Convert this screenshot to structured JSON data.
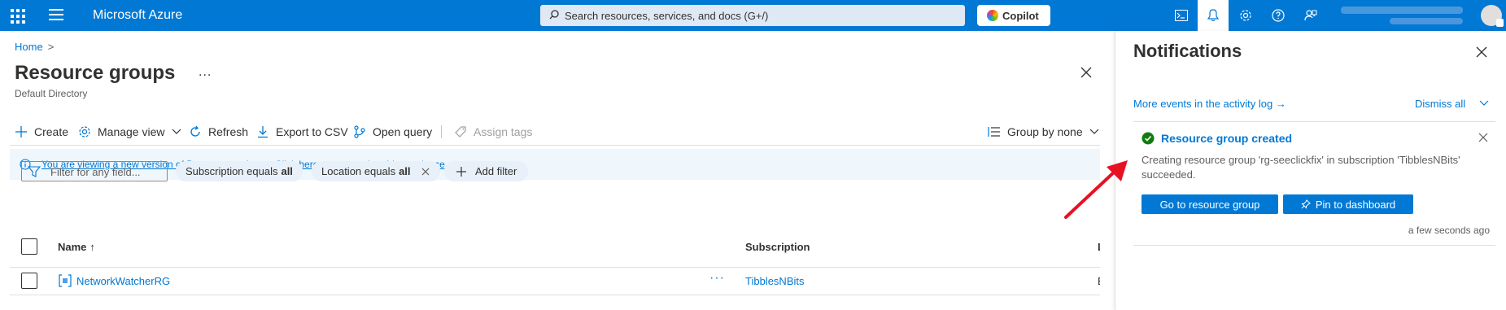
{
  "header": {
    "brand": "Microsoft Azure",
    "search_placeholder": "Search resources, services, and docs (G+/)",
    "copilot_label": "Copilot",
    "icons": [
      "waffle-icon",
      "hamburger-icon",
      "cloud-shell-icon",
      "bell-icon",
      "gear-icon",
      "help-icon",
      "feedback-icon"
    ]
  },
  "breadcrumb": {
    "home": "Home",
    "sep": ">"
  },
  "page": {
    "title": "Resource groups",
    "more": "...",
    "subtitle": "Default Directory"
  },
  "toolbar": {
    "create": "Create",
    "manage_view": "Manage view",
    "refresh": "Refresh",
    "export": "Export to CSV",
    "open_query": "Open query",
    "assign_tags": "Assign tags",
    "group_by": "Group by none"
  },
  "info_banner": "You are viewing a new version of Browse experience. Click here to access the old experience.",
  "filters": {
    "search_placeholder": "Filter for any field...",
    "subscription_label": "Subscription equals",
    "subscription_value": "all",
    "location_label": "Location equals",
    "location_value": "all",
    "add_filter": "Add filter"
  },
  "grid": {
    "columns": {
      "name": "Name",
      "sort_arrow": "↑",
      "subscription": "Subscription",
      "location": "L"
    },
    "rows": [
      {
        "name": "NetworkWatcherRG",
        "subscription": "TibblesNBits",
        "location": "E",
        "more": "···"
      }
    ]
  },
  "notifications": {
    "title": "Notifications",
    "more_events": "More events in the activity log →",
    "dismiss_all": "Dismiss all",
    "items": [
      {
        "title": "Resource group created",
        "description": "Creating resource group 'rg-seeclickfix' in subscription 'TibblesNBits' succeeded.",
        "primary_button": "Go to resource group",
        "secondary_button": "Pin to dashboard",
        "time": "a few seconds ago"
      }
    ]
  },
  "colors": {
    "accent": "#0078d4",
    "success": "#107c10",
    "annotation": "#e81123"
  }
}
